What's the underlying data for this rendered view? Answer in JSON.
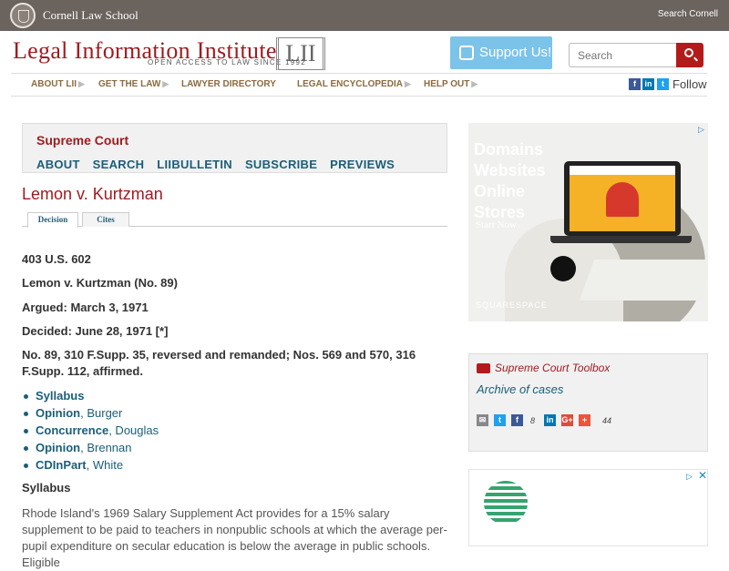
{
  "topbar": {
    "school": "Cornell Law School",
    "search_link": "Search Cornell"
  },
  "brand": {
    "name": "Legal Information Institute",
    "tagline": "OPEN ACCESS TO LAW SINCE 1992",
    "mark": "LII"
  },
  "support": {
    "label": "Support Us!"
  },
  "search": {
    "placeholder": "Search"
  },
  "nav": {
    "items": [
      {
        "label": "ABOUT LII"
      },
      {
        "label": "GET THE LAW"
      },
      {
        "label": "LAWYER DIRECTORY"
      },
      {
        "label": "LEGAL ENCYCLOPEDIA"
      },
      {
        "label": "HELP OUT"
      }
    ]
  },
  "social": {
    "follow": "Follow"
  },
  "court_box": {
    "title": "Supreme Court",
    "links": [
      "ABOUT",
      "SEARCH",
      "LIIBULLETIN",
      "SUBSCRIBE",
      "PREVIEWS"
    ]
  },
  "case": {
    "title": "Lemon v. Kurtzman",
    "tabs": [
      "Decision",
      "Cites"
    ],
    "citation": "403 U.S. 602",
    "name_line": "Lemon v. Kurtzman (No. 89)",
    "argued": "Argued: March 3, 1971",
    "decided": "Decided: June 28, 1971 [*]",
    "disposition": "No. 89, 310 F.Supp. 35, reversed and remanded; Nos. 569 and 570, 316 F.Supp. 112, affirmed.",
    "opinions": [
      {
        "type": "Syllabus",
        "author": ""
      },
      {
        "type": "Opinion",
        "author": ", Burger"
      },
      {
        "type": "Concurrence",
        "author": ", Douglas"
      },
      {
        "type": "Opinion",
        "author": ", Brennan"
      },
      {
        "type": "CDInPart",
        "author": ", White"
      }
    ],
    "syllabus_head": "Syllabus",
    "syllabus_text": "Rhode Island's 1969 Salary Supplement Act provides for a 15% salary supplement to be paid to teachers in nonpublic schools at which the average per-pupil expenditure on secular education is below the average in public schools. Eligible"
  },
  "ad1": {
    "headline": "Domains\nWebsites\nOnline\nStores",
    "cta": "Start Now",
    "brand": "SQUARESPACE"
  },
  "toolbox": {
    "title": "Supreme Court Toolbox",
    "archive": "Archive of cases",
    "facebook_count": "8",
    "total_count": "44"
  }
}
